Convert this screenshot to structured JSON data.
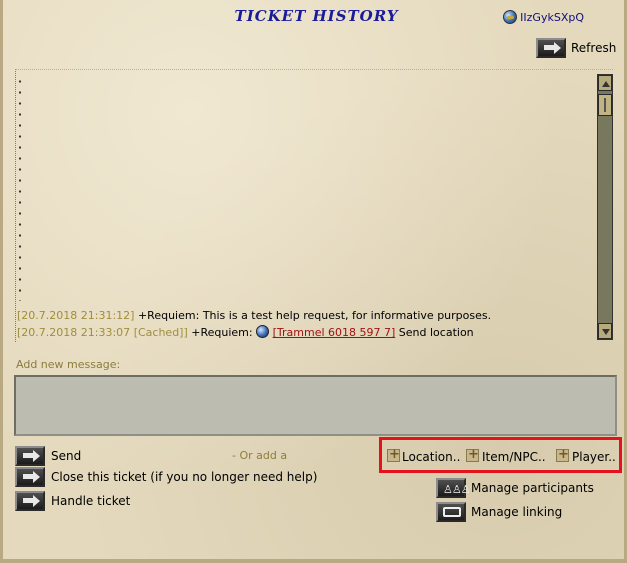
{
  "window": {
    "title": "TICKET HISTORY",
    "user": "IIzGykSXpQ"
  },
  "toolbar": {
    "refresh_label": "Refresh"
  },
  "history": {
    "messages": [
      {
        "timestamp": "[20.7.2018  21:31:12]",
        "cached": "",
        "author": "+Requiem:",
        "text": "This is a test help request, for informative purposes."
      },
      {
        "timestamp": "[20.7.2018  21:33:07",
        "cached": "[Cached]]",
        "author": "+Requiem:",
        "location": "[Trammel 6018 597 7]",
        "text": "Send location"
      }
    ]
  },
  "compose": {
    "label": "Add new message:",
    "value": ""
  },
  "actions": {
    "send": "Send",
    "close": "Close this ticket (if you no longer need help)",
    "handle": "Handle ticket",
    "or_add": "- Or add a",
    "location": "Location..",
    "item_npc": "Item/NPC..",
    "player": "Player..",
    "manage_participants": "Manage participants",
    "manage_linking": "Manage linking"
  },
  "colors": {
    "title": "#1a1a9c",
    "link": "#a01212",
    "timestamp": "#a08d3c",
    "highlight": "#e3131e"
  },
  "icons": [
    "globe-icon",
    "arrow-right-icon",
    "scroll-up-icon",
    "scroll-down-icon",
    "plus-icon",
    "participants-icon",
    "link-icon"
  ]
}
